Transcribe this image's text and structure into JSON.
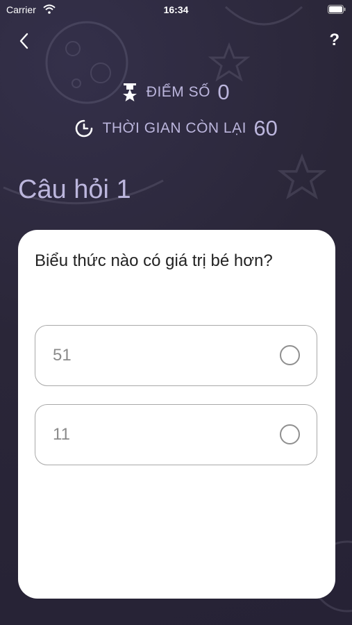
{
  "status_bar": {
    "carrier": "Carrier",
    "time": "16:34"
  },
  "nav": {
    "help_label": "?"
  },
  "stats": {
    "score_label": "ĐIỂM SỐ",
    "score_value": "0",
    "time_label": "THỜI GIAN CÒN LẠI",
    "time_value": "60"
  },
  "question": {
    "heading": "Câu hỏi 1",
    "text": "Biểu thức nào có giá trị bé hơn?",
    "options": [
      {
        "label": "51",
        "selected": false
      },
      {
        "label": "11",
        "selected": false
      }
    ]
  },
  "colors": {
    "background": "#2a2638",
    "accent_text": "#bcb6dd",
    "card": "#ffffff"
  }
}
